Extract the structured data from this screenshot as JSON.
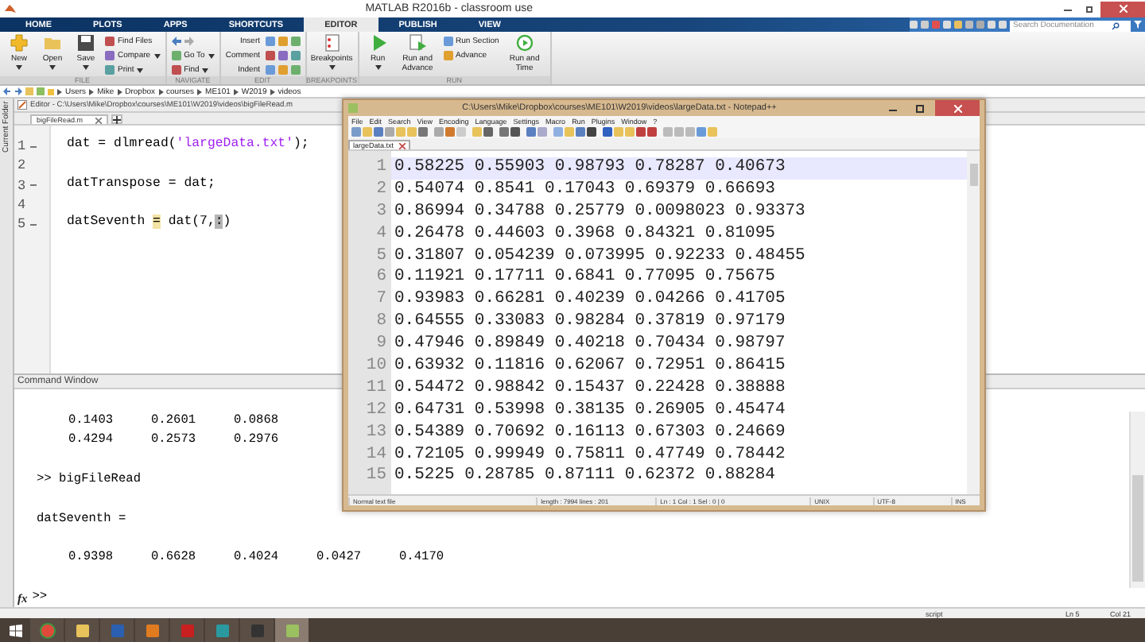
{
  "window": {
    "title": "MATLAB R2016b - classroom use"
  },
  "ribbon_tabs": [
    {
      "label": "HOME",
      "selected": false
    },
    {
      "label": "PLOTS",
      "selected": false
    },
    {
      "label": "APPS",
      "selected": false
    },
    {
      "label": "SHORTCUTS",
      "selected": false
    },
    {
      "label": "EDITOR",
      "selected": true
    },
    {
      "label": "PUBLISH",
      "selected": false
    },
    {
      "label": "VIEW",
      "selected": false
    }
  ],
  "search": {
    "placeholder": "Search Documentation"
  },
  "toolstrip": [
    {
      "label": "FILE",
      "buttons": [
        {
          "kind": "large",
          "label": "New",
          "dropdown": true
        },
        {
          "kind": "large",
          "label": "Open",
          "dropdown": true
        },
        {
          "kind": "large",
          "label": "Save",
          "dropdown": true
        },
        {
          "kind": "small",
          "label": "Find Files",
          "dropdown": false
        },
        {
          "kind": "small",
          "label": "Compare",
          "dropdown": true
        },
        {
          "kind": "small",
          "label": "Print",
          "dropdown": true
        }
      ]
    },
    {
      "label": "NAVIGATE",
      "buttons": [
        {
          "kind": "arrows"
        },
        {
          "kind": "small",
          "label": "Go To",
          "dropdown": true
        },
        {
          "kind": "small",
          "label": "Find",
          "dropdown": true
        }
      ]
    },
    {
      "label": "EDIT",
      "buttons": [
        {
          "kind": "small",
          "label": "Insert",
          "dropdown": false
        },
        {
          "kind": "small",
          "label": "Comment",
          "dropdown": false
        },
        {
          "kind": "small",
          "label": "Indent",
          "dropdown": false
        },
        {
          "kind": "icon_grid"
        }
      ]
    },
    {
      "label": "BREAKPOINTS",
      "buttons": [
        {
          "kind": "large",
          "label": "Breakpoints",
          "dropdown": true
        }
      ]
    },
    {
      "label": "RUN",
      "buttons": [
        {
          "kind": "large",
          "label": "Run",
          "dropdown": true
        },
        {
          "kind": "large",
          "label": "Run and Advance",
          "dropdown": false
        },
        {
          "kind": "small",
          "label": "Run Section",
          "dropdown": false
        },
        {
          "kind": "small",
          "label": "Advance",
          "dropdown": false
        },
        {
          "kind": "large",
          "label": "Run and Time",
          "dropdown": false
        }
      ]
    }
  ],
  "address_bar": {
    "path": [
      "Users",
      "Mike",
      "Dropbox",
      "courses",
      "ME101",
      "W2019",
      "videos"
    ]
  },
  "side_panel": {
    "label": "Current Folder"
  },
  "editor": {
    "title": "Editor - C:\\Users\\Mike\\Dropbox\\courses\\ME101\\W2019\\videos\\bigFileRead.m",
    "tabs": [
      {
        "label": "bigFileRead.m",
        "selected": true
      }
    ],
    "lines": [
      {
        "number": "1",
        "executable": true,
        "segments": [
          {
            "kind": "plain",
            "text": "dat = dlmread("
          },
          {
            "kind": "string",
            "text": "'largeData.txt'"
          },
          {
            "kind": "plain",
            "text": ");"
          }
        ]
      },
      {
        "number": "2",
        "executable": false
      },
      {
        "number": "3",
        "executable": true,
        "segments": [
          {
            "kind": "plain",
            "text": "datTranspose = dat;"
          }
        ]
      },
      {
        "number": "4",
        "executable": false
      },
      {
        "number": "5",
        "executable": true,
        "segments": [
          {
            "kind": "plain",
            "text": "datSeventh "
          },
          {
            "kind": "match",
            "text": "="
          },
          {
            "kind": "plain",
            "text": " dat(7,"
          },
          {
            "kind": "cursor",
            "text": ":"
          },
          {
            "kind": "plain",
            "text": ")"
          }
        ]
      }
    ]
  },
  "command_window": {
    "title": "Command Window",
    "lines": [
      {
        "kind": "values",
        "values": [
          "0.1403",
          "0.2601",
          "0.0868"
        ]
      },
      {
        "kind": "values",
        "values": [
          "0.4294",
          "0.2573",
          "0.2976"
        ]
      },
      {
        "kind": "blank"
      },
      {
        "kind": "command",
        "prompt": ">>",
        "text": "bigFileRead"
      },
      {
        "kind": "blank"
      },
      {
        "kind": "text",
        "text": "datSeventh ="
      },
      {
        "kind": "blank"
      },
      {
        "kind": "values",
        "values": [
          "0.9398",
          "0.6628",
          "0.4024",
          "0.0427",
          "0.4170"
        ]
      },
      {
        "kind": "blank"
      }
    ],
    "function_label": "fx",
    "prompt": ">>"
  },
  "status_bar": {
    "mode": "script",
    "line": "Ln 5",
    "column": "Col 21"
  },
  "notepad": {
    "title": "C:\\Users\\Mike\\Dropbox\\courses\\ME101\\W2019\\videos\\largeData.txt - Notepad++",
    "menu": [
      "File",
      "Edit",
      "Search",
      "View",
      "Encoding",
      "Language",
      "Settings",
      "Macro",
      "Run",
      "Plugins",
      "Window",
      "?"
    ],
    "tabs": [
      {
        "label": "largeData.txt",
        "selected": true
      }
    ],
    "lines": [
      {
        "number": "1",
        "text": "0.58225 0.55903 0.98793 0.78287 0.40673",
        "current": true
      },
      {
        "number": "2",
        "text": "0.54074 0.8541 0.17043 0.69379 0.66693",
        "current": false
      },
      {
        "number": "3",
        "text": "0.86994 0.34788 0.25779 0.0098023 0.93373",
        "current": false
      },
      {
        "number": "4",
        "text": "0.26478 0.44603 0.3968 0.84321 0.81095",
        "current": false
      },
      {
        "number": "5",
        "text": "0.31807 0.054239 0.073995 0.92233 0.48455",
        "current": false
      },
      {
        "number": "6",
        "text": "0.11921 0.17711 0.6841 0.77095 0.75675",
        "current": false
      },
      {
        "number": "7",
        "text": "0.93983 0.66281 0.40239 0.04266 0.41705",
        "current": false
      },
      {
        "number": "8",
        "text": "0.64555 0.33083 0.98284 0.37819 0.97179",
        "current": false
      },
      {
        "number": "9",
        "text": "0.47946 0.89849 0.40218 0.70434 0.98797",
        "current": false
      },
      {
        "number": "10",
        "text": "0.63932 0.11816 0.62067 0.72951 0.86415",
        "current": false
      },
      {
        "number": "11",
        "text": "0.54472 0.98842 0.15437 0.22428 0.38888",
        "current": false
      },
      {
        "number": "12",
        "text": "0.64731 0.53998 0.38135 0.26905 0.45474",
        "current": false
      },
      {
        "number": "13",
        "text": "0.54389 0.70692 0.16113 0.67303 0.24669",
        "current": false
      },
      {
        "number": "14",
        "text": "0.72105 0.99949 0.75811 0.47749 0.78442",
        "current": false
      },
      {
        "number": "15",
        "text": "0.5225 0.28785 0.87111 0.62372 0.88284",
        "current": false
      }
    ],
    "status": [
      "Normal text file",
      "length : 7994   lines : 201",
      "Ln : 1   Col : 1   Sel : 0 | 0",
      "UNIX",
      "UTF-8",
      "INS"
    ]
  },
  "taskbar": [
    {
      "selected": false
    },
    {
      "selected": false
    },
    {
      "selected": false
    },
    {
      "selected": false
    },
    {
      "selected": false
    },
    {
      "selected": false
    },
    {
      "selected": false
    },
    {
      "selected": true
    }
  ]
}
